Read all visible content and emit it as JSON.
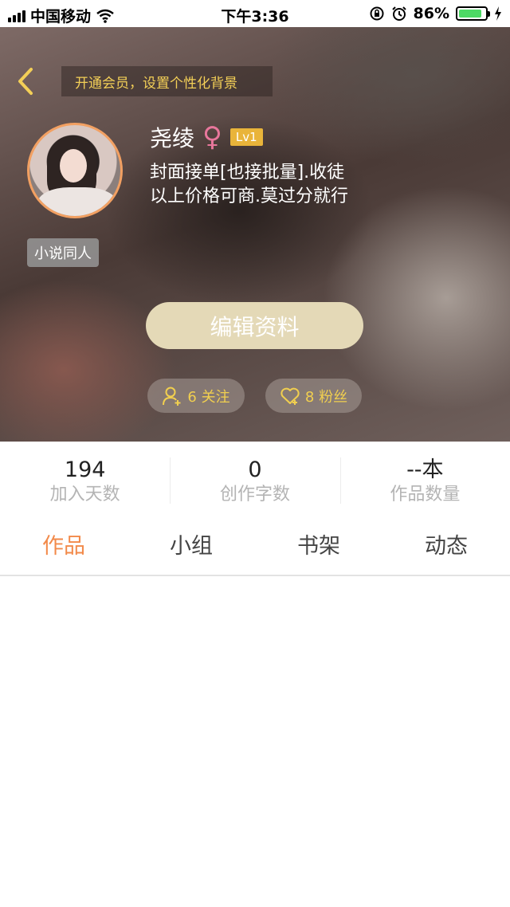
{
  "status_bar": {
    "carrier": "中国移动",
    "time": "下午3:36",
    "battery_percent": "86%",
    "battery_level": 0.86
  },
  "header": {
    "vip_banner": "开通会员，设置个性化背景",
    "username": "尧绫",
    "gender_symbol": "♀",
    "level": "Lv1",
    "bio_line1": "封面接单[也接批量].收徒",
    "bio_line2": "以上价格可商.莫过分就行",
    "tag": "小说同人",
    "edit_button": "编辑资料",
    "following": "6 关注",
    "fans": "8 粉丝"
  },
  "stats": [
    {
      "value": "194",
      "label": "加入天数"
    },
    {
      "value": "0",
      "label": "创作字数"
    },
    {
      "value": "--本",
      "label": "作品数量"
    }
  ],
  "tabs": [
    {
      "label": "作品",
      "active": true
    },
    {
      "label": "小组",
      "active": false
    },
    {
      "label": "书架",
      "active": false
    },
    {
      "label": "动态",
      "active": false
    }
  ],
  "colors": {
    "accent": "#f28a4a",
    "gold": "#f1cf4f",
    "edit_button": "#e4d9b7",
    "level_badge": "#e9b43a",
    "gender": "#e8779c"
  },
  "icons": [
    "signal-icon",
    "wifi-icon",
    "lock-rotation-icon",
    "alarm-icon",
    "battery-icon",
    "charging-icon",
    "back-chevron-icon",
    "add-user-icon",
    "heart-icon"
  ]
}
